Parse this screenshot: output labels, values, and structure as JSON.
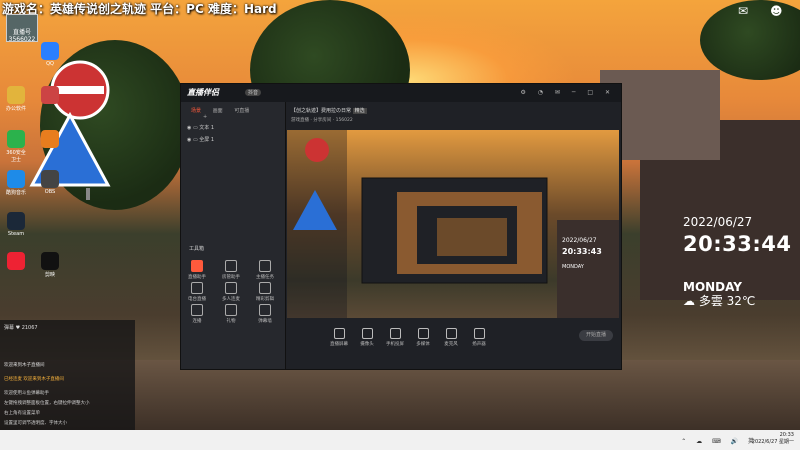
{
  "stream_caption": "游戏名：英雄传说创之轨迹 平台：PC 难度：Hard",
  "overlay": {
    "avatar_label": "直播号",
    "avatar_id": "3566022"
  },
  "desktop_icons": [
    {
      "label": "QQ",
      "color": "#2a7fff"
    },
    {
      "label": "办公软件",
      "color": "#e2b43c"
    },
    {
      "label": "",
      "color": "#c44"
    },
    {
      "label": "360安全卫士",
      "color": "#2bb24c"
    },
    {
      "label": "",
      "color": "#e87d1e"
    },
    {
      "label": "酷狗音乐",
      "color": "#1e8be8"
    },
    {
      "label": "OBS",
      "color": "#444"
    },
    {
      "label": "Steam",
      "color": "#1b2838"
    },
    {
      "label": "剪映",
      "color": "#111"
    },
    {
      "label": "",
      "color": "#e23"
    }
  ],
  "widget": {
    "date": "2022/06/27",
    "time": "20:33:44",
    "day": "MONDAY",
    "weather": "☁ 多雲 32℃"
  },
  "app": {
    "logo": "直播伴侣",
    "logo_badge": "抖音",
    "tabs": [
      "场景",
      "画面",
      "可直播"
    ],
    "scenes": [
      "文本 1",
      "全屏 1"
    ],
    "tools_title": "工具箱",
    "tools": [
      "直播助手",
      "房管助手",
      "主播任务",
      "电台直播",
      "多人连麦",
      "精彩剪辑",
      "连播",
      "礼物",
      "弹幕墙"
    ],
    "title": "【创之轨迹】费用拉の日常",
    "title_tag": "精选",
    "subtitle": "游戏直播 · 分享房间 · 156022",
    "bottom_buttons": [
      "直播屏幕",
      "摄像头",
      "手机投屏",
      "多媒体",
      "麦克风",
      "扬声器"
    ],
    "start_button": "开始直播",
    "stats": "CPU 2%  内存 1%  FPS 0"
  },
  "chat": {
    "header": "彈幕",
    "count": "21067",
    "lines": [
      {
        "text": "欢迎来到木子直播间",
        "color": "#ddd"
      },
      {
        "text": "已经连麦 欢迎来到木子直播间",
        "color": "#f7b23c"
      },
      {
        "text": "欢迎使用斗鱼弹幕助手",
        "color": "#ccc"
      },
      {
        "text": "左键拖拽调整面板位置，右键拉伸调整大小",
        "color": "#ccc"
      },
      {
        "text": "右上角有设置菜单",
        "color": "#ccc"
      },
      {
        "text": "设置里可调节透明度、字体大小",
        "color": "#ccc"
      },
      {
        "text": "添加弹幕助手成功",
        "color": "#ccc"
      }
    ]
  },
  "taskbar": {
    "time": "20:33",
    "date": "2022/6/27 星期一"
  }
}
